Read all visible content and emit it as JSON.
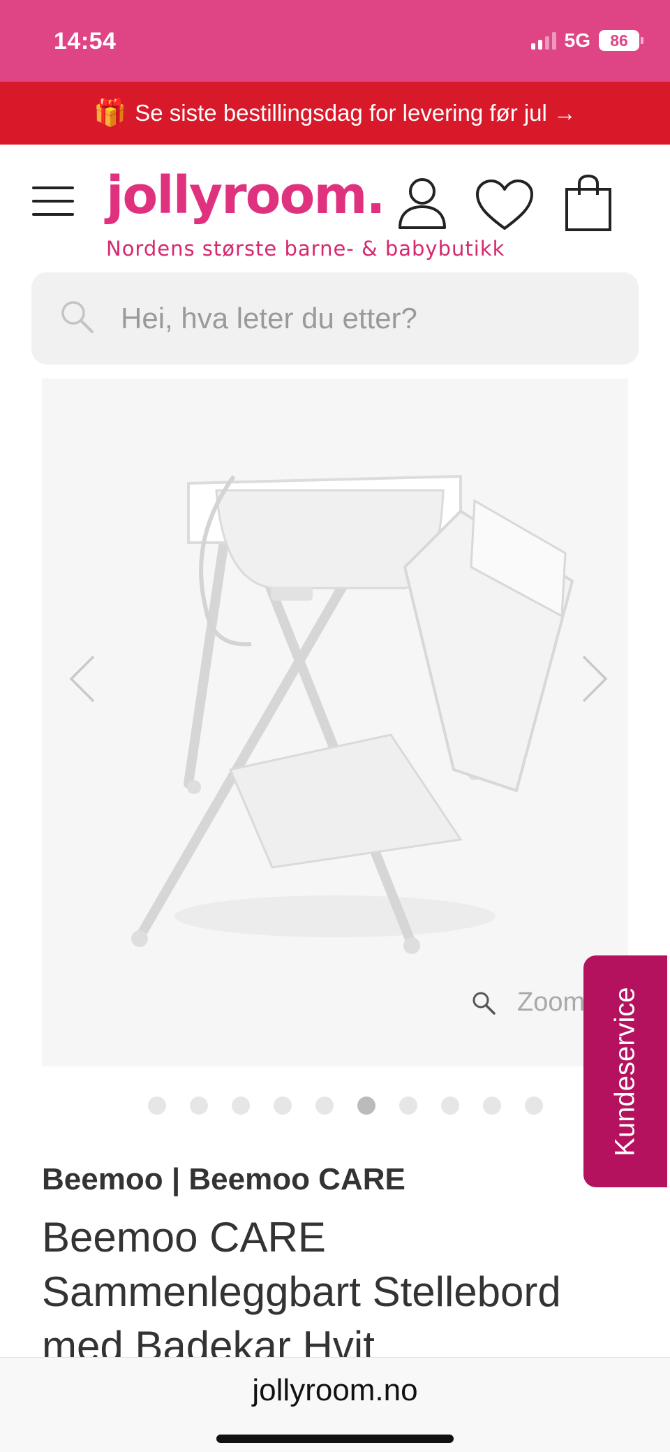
{
  "status_bar": {
    "time": "14:54",
    "network": "5G",
    "battery": "86"
  },
  "promo": {
    "icon": "gift-icon",
    "text": "Se siste bestillingsdag for levering før jul →"
  },
  "header": {
    "logo": "jollyroom.",
    "tagline": "Nordens største barne- & babybutikk",
    "icons": [
      "menu-icon",
      "account-icon",
      "heart-icon",
      "bag-icon"
    ]
  },
  "search": {
    "placeholder": "Hei, hva leter du etter?"
  },
  "gallery": {
    "zoom_label": "Zoom",
    "total_images": 10,
    "active_index": 5
  },
  "product": {
    "brand": "Beemoo | Beemoo CARE",
    "title": "Beemoo CARE Sammenleggbart Stellebord med Badekar Hvit"
  },
  "kundeservice": {
    "label": "Kundeservice"
  },
  "browser": {
    "url": "jollyroom.no"
  },
  "colors": {
    "status_bar": "#df4585",
    "promo": "#d8192a",
    "brand_pink": "#e0317f",
    "kundeservice": "#b4125e"
  }
}
